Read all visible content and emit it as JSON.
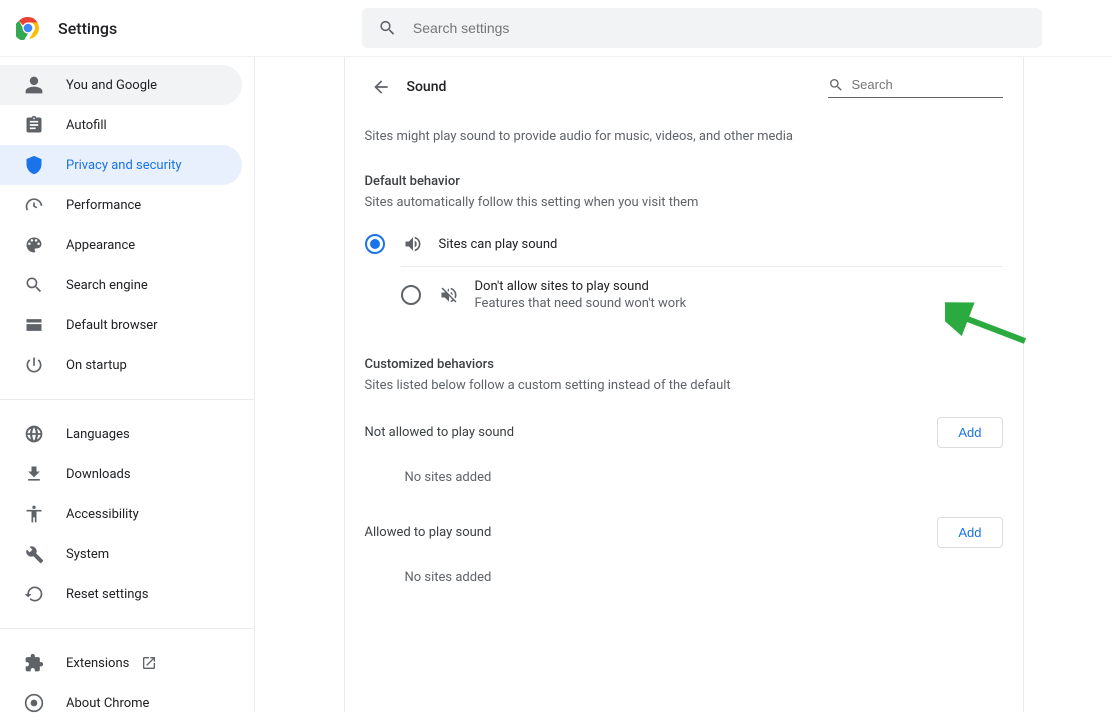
{
  "header": {
    "title": "Settings",
    "search_placeholder": "Search settings"
  },
  "sidebar": {
    "items": [
      {
        "id": "you-and-google",
        "label": "You and Google",
        "icon": "person"
      },
      {
        "id": "autofill",
        "label": "Autofill",
        "icon": "assignment"
      },
      {
        "id": "privacy-and-security",
        "label": "Privacy and security",
        "icon": "security"
      },
      {
        "id": "performance",
        "label": "Performance",
        "icon": "speed"
      },
      {
        "id": "appearance",
        "label": "Appearance",
        "icon": "palette"
      },
      {
        "id": "search-engine",
        "label": "Search engine",
        "icon": "search"
      },
      {
        "id": "default-browser",
        "label": "Default browser",
        "icon": "browser"
      },
      {
        "id": "on-startup",
        "label": "On startup",
        "icon": "power"
      },
      {
        "id": "languages",
        "label": "Languages",
        "icon": "globe"
      },
      {
        "id": "downloads",
        "label": "Downloads",
        "icon": "download"
      },
      {
        "id": "accessibility",
        "label": "Accessibility",
        "icon": "accessibility"
      },
      {
        "id": "system",
        "label": "System",
        "icon": "build"
      },
      {
        "id": "reset-settings",
        "label": "Reset settings",
        "icon": "restore"
      },
      {
        "id": "extensions",
        "label": "Extensions",
        "icon": "extension"
      },
      {
        "id": "about-chrome",
        "label": "About Chrome",
        "icon": "chrome"
      }
    ]
  },
  "panel": {
    "title": "Sound",
    "search_placeholder": "Search",
    "intro": "Sites might play sound to provide audio for music, videos, and other media",
    "default_section_title": "Default behavior",
    "default_section_sub": "Sites automatically follow this setting when you visit them",
    "option_allow": {
      "label": "Sites can play sound",
      "selected": true
    },
    "option_block": {
      "label": "Don't allow sites to play sound",
      "sublabel": "Features that need sound won't work",
      "selected": false
    },
    "custom_section_title": "Customized behaviors",
    "custom_section_sub": "Sites listed below follow a custom setting instead of the default",
    "not_allowed_label": "Not allowed to play sound",
    "allowed_label": "Allowed to play sound",
    "add_button": "Add",
    "no_sites": "No sites added"
  }
}
